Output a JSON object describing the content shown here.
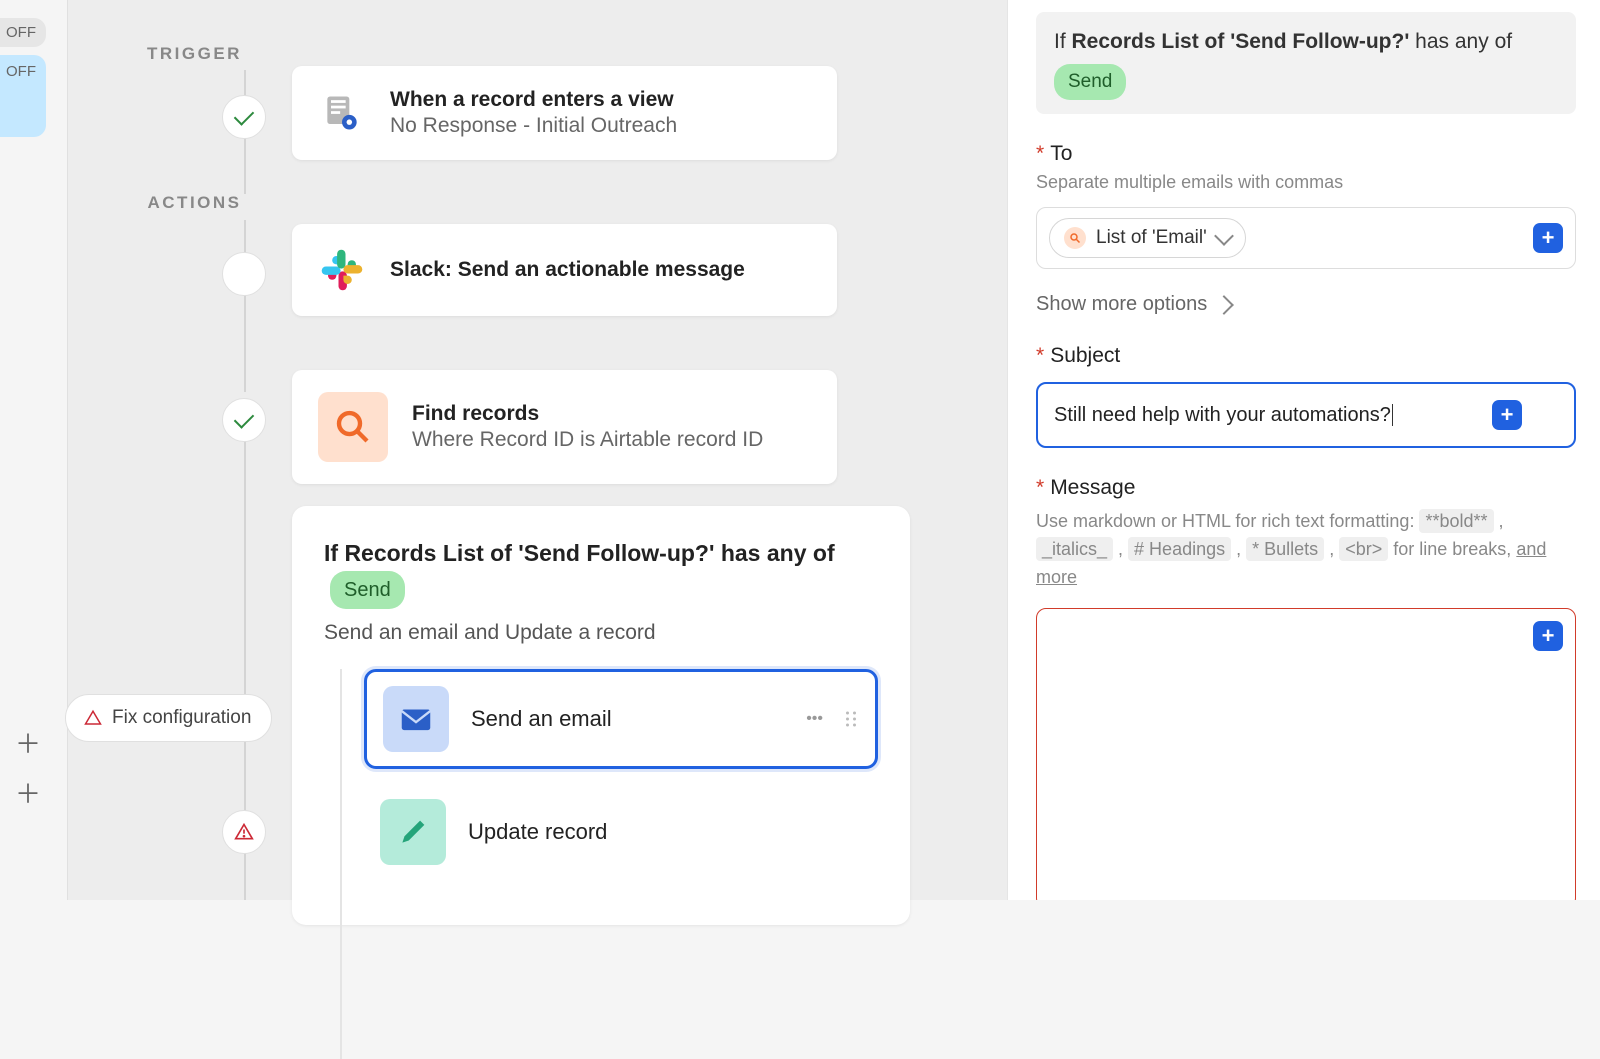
{
  "edge": {
    "off1": "OFF",
    "off2": "OFF"
  },
  "canvas": {
    "trigger_label": "TRIGGER",
    "actions_label": "ACTIONS",
    "trigger": {
      "title": "When a record enters a view",
      "subtitle": "No Response - Initial Outreach"
    },
    "action_slack": {
      "title": "Slack: Send an actionable message"
    },
    "action_find": {
      "title": "Find records",
      "subtitle": "Where Record ID is Airtable record ID"
    },
    "conditional": {
      "prefix": "If Records ",
      "list_of": "List of 'Send Follow-up?'",
      "suffix": " has any of",
      "tag": "Send",
      "subtitle": "Send an email and Update a record",
      "inner": {
        "send_email": "Send an email",
        "update_record": "Update record"
      }
    },
    "fix_config": "Fix configuration"
  },
  "panel": {
    "summary": {
      "prefix": "If ",
      "strong": "Records List of 'Send Follow-up?'",
      "suffix": " has any of",
      "tag": "Send"
    },
    "to": {
      "label": "To",
      "help": "Separate multiple emails with commas",
      "chip": "List of 'Email'"
    },
    "show_more": "Show more options",
    "subject": {
      "label": "Subject",
      "value": "Still need help with your automations?"
    },
    "message": {
      "label": "Message",
      "help_prefix": "Use markdown or HTML for rich text formatting: ",
      "bold": "**bold**",
      "italics": "_italics_",
      "headings": "# Headings",
      "bullets": "* Bullets",
      "br": "<br>",
      "linebreaks": " for line breaks, ",
      "more": "and more"
    }
  }
}
